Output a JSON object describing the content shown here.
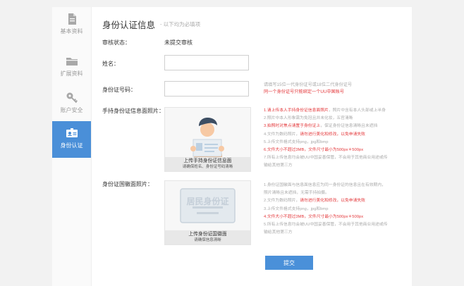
{
  "sidebar": {
    "items": [
      {
        "label": "基本资料",
        "icon": "document-icon"
      },
      {
        "label": "扩展资料",
        "icon": "folder-icon"
      },
      {
        "label": "账户安全",
        "icon": "key-icon"
      },
      {
        "label": "身份认证",
        "icon": "id-card-icon",
        "active": true
      }
    ]
  },
  "header": {
    "title": "身份认证信息",
    "subtitle": "- 以下均为必填项"
  },
  "form": {
    "status_label": "审核状态：",
    "status_value": "未提交审核",
    "name_label": "姓名：",
    "name_value": "",
    "idno_label": "身份证号码：",
    "idno_value": "",
    "idno_hint_1": "请填写15位一代身份证号或18位二代身份证号",
    "idno_hint_2": "同一个身份证号只能绑定一个UU中国账号",
    "handheld_label": "手持身份证信息面照片：",
    "emblem_label": "身份证国徽面照片："
  },
  "handheld_upload": {
    "caption_1": "上传手持身份证信息面",
    "caption_2": "请确保姓名、身份证号码清晰"
  },
  "handheld_rules": [
    {
      "n": "1.",
      "text": "请上传本人手持身份证信息面照片",
      "tail": "，照片中含有本人头部或上半身",
      "red": true
    },
    {
      "n": "2.",
      "text": "照片中本人形象需为免冠且并未化妆，五官清晰",
      "tail": "",
      "red": false
    },
    {
      "n": "3.",
      "text": "拍照时对焦点请置于身份证上",
      "tail": "，保证身份证信息清晰且未遮挡",
      "red": true
    },
    {
      "n": "4.",
      "text": "文件为数码照片，",
      "tail": "请勿进行美化和修改，以免申请失败",
      "red": "tail"
    },
    {
      "n": "5.",
      "text": "上传文件格式支持png，jpg和bmp",
      "tail": "",
      "red": false
    },
    {
      "n": "6.",
      "text": "文件大小不超过3MB，文件尺寸最小为500px＊500px",
      "tail": "",
      "red": true
    },
    {
      "n": "7.",
      "text": "所有上传信息均会被UU中国妥善保管，不会用于其他商业用途或传",
      "tail": "",
      "red": false
    },
    {
      "n": "",
      "text": "输给其他第三方",
      "tail": "",
      "red": false
    }
  ],
  "emblem_upload": {
    "card_text": "居民身份证",
    "caption_1": "上传身份证国徽面",
    "caption_2": "请确保信息清晰"
  },
  "emblem_rules": [
    {
      "n": "1.",
      "text": "身份证国徽面与信息面信息应为同一身份证的信息且在有效期内，",
      "tail": "",
      "red": false
    },
    {
      "n": "",
      "text": "照片清晰且未遮挡，无需手持拍摄。",
      "tail": "",
      "red": false
    },
    {
      "n": "2.",
      "text": "文件为数码照片，",
      "tail": "请勿进行美化和修改，以免申请失败",
      "red": "tail"
    },
    {
      "n": "3.",
      "text": "上传文件格式支持png，jpg和bmp",
      "tail": "",
      "red": false
    },
    {
      "n": "4.",
      "text": "文件大小不超过3MB，文件尺寸最小为500px＊500px",
      "tail": "",
      "red": true
    },
    {
      "n": "5.",
      "text": "所有上传信息均会被UU中国妥善保管，不会用于其他商业用途或传",
      "tail": "",
      "red": false
    },
    {
      "n": "",
      "text": "输给其他第三方",
      "tail": "",
      "red": false
    }
  ],
  "submit_label": "提交",
  "colors": {
    "accent": "#4a8fd8",
    "red": "#e4393c",
    "hint": "#aaaaaa"
  }
}
